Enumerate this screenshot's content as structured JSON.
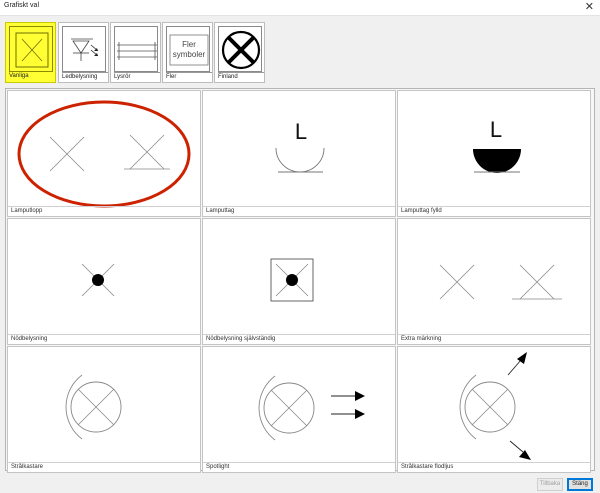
{
  "window": {
    "title": "Grafiskt val",
    "close_glyph": "✕"
  },
  "categories": [
    {
      "label": "Vanliga",
      "icon": "lamp-outlet-x-icon",
      "selected": true
    },
    {
      "label": "Ledbelysning",
      "icon": "led-lighting-icon",
      "selected": false
    },
    {
      "label": "Lysrör",
      "icon": "fluorescent-tube-icon",
      "selected": false
    },
    {
      "label": "Fler",
      "icon": "more-symbols-icon",
      "selected": false,
      "icon_text_1": "Fler",
      "icon_text_2": "symboler"
    },
    {
      "label": "Finland",
      "icon": "finland-x-icon",
      "selected": false
    }
  ],
  "symbols": [
    {
      "label": "Lamputlopp",
      "icon": "lamp-outlet-icon",
      "highlighted": true
    },
    {
      "label": "Lamputtag",
      "icon": "lamp-socket-icon",
      "glyph": "L"
    },
    {
      "label": "Lamputtag fylld",
      "icon": "lamp-socket-filled-icon",
      "glyph": "L"
    },
    {
      "label": "Nödbelysning",
      "icon": "emergency-lighting-icon"
    },
    {
      "label": "Nödbelysning självständig",
      "icon": "emergency-lighting-standalone-icon"
    },
    {
      "label": "Extra märkning",
      "icon": "extra-marking-icon"
    },
    {
      "label": "Strålkastare",
      "icon": "spotlight-floodlight-icon"
    },
    {
      "label": "Spotlight",
      "icon": "spotlight-icon"
    },
    {
      "label": "Strålkastare flodljus",
      "icon": "floodlight-arrows-icon"
    }
  ],
  "buttons": {
    "back": "Tillbaka",
    "close": "Stäng"
  },
  "colors": {
    "selected": "#ffff33",
    "highlight_ellipse": "#cc2200",
    "default_button_border": "#0078d7"
  }
}
